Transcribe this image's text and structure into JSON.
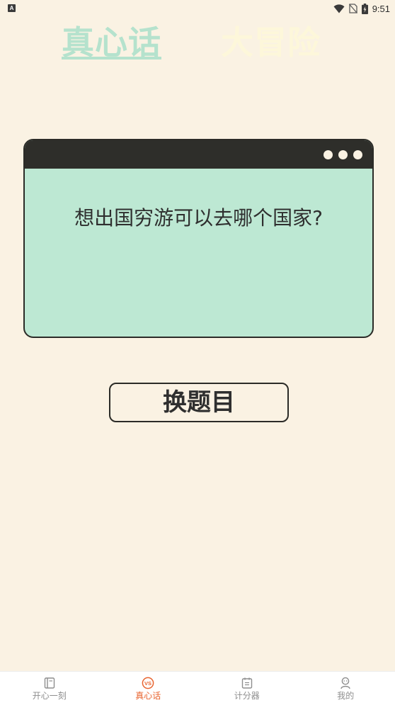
{
  "status_bar": {
    "app_icon_letter": "A",
    "time": "9:51"
  },
  "mode_tabs": {
    "truth_label": "真心话",
    "dare_label": "大冒险",
    "active": "truth"
  },
  "question_card": {
    "question": "想出国穷游可以去哪个国家?"
  },
  "change_button": {
    "label": "换题目"
  },
  "bottom_nav": {
    "items": [
      {
        "label": "开心一刻",
        "icon": "book-icon",
        "active": false
      },
      {
        "label": "真心话",
        "icon": "vs-icon",
        "active": true
      },
      {
        "label": "计分器",
        "icon": "scoreboard-icon",
        "active": false
      },
      {
        "label": "我的",
        "icon": "user-icon",
        "active": false
      }
    ]
  },
  "colors": {
    "background": "#FAF2E3",
    "card_body": "#BDE8D3",
    "card_titlebar": "#2E2E2A",
    "truth_tab": "#B5E2CD",
    "dare_tab": "#FDF7DA",
    "nav_active": "#E8632E",
    "nav_inactive": "#8E8E8E"
  }
}
